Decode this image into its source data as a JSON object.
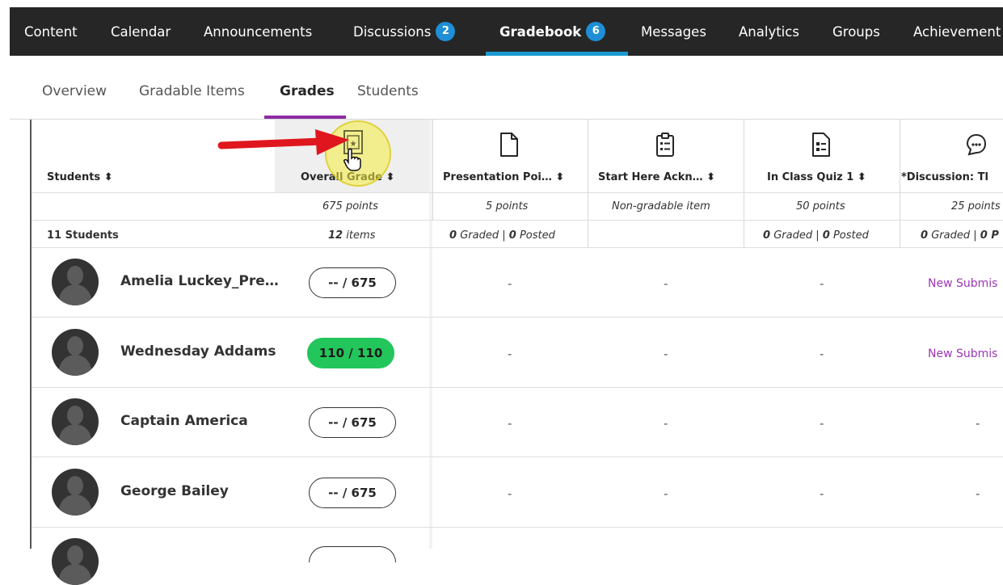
{
  "topnav": {
    "tabs": [
      {
        "label": "Content"
      },
      {
        "label": "Calendar"
      },
      {
        "label": "Announcements"
      },
      {
        "label": "Discussions",
        "badge": "2"
      },
      {
        "label": "Gradebook",
        "badge": "6",
        "active": true
      },
      {
        "label": "Messages"
      },
      {
        "label": "Analytics"
      },
      {
        "label": "Groups"
      },
      {
        "label": "Achievement"
      }
    ]
  },
  "subtabs": [
    {
      "label": "Overview"
    },
    {
      "label": "Gradable Items"
    },
    {
      "label": "Grades",
      "active": true
    },
    {
      "label": "Students"
    }
  ],
  "grid": {
    "students_header": "Students",
    "sort_glyph": "⬍",
    "columns": [
      {
        "label": "Overall Grade",
        "points": "675 points",
        "summary_num": "12",
        "summary_txt": "items",
        "icon": "overall-grade-icon"
      },
      {
        "label": "Presentation Poi…",
        "points": "5 points",
        "graded": "0",
        "posted": "0",
        "icon": "document-icon"
      },
      {
        "label": "Start Here Ackn…",
        "points": "Non-gradable item",
        "icon": "clipboard-icon"
      },
      {
        "label": "In Class Quiz 1",
        "points": "50 points",
        "graded": "0",
        "posted": "0",
        "icon": "quiz-icon"
      },
      {
        "label": "*Discussion: Tl",
        "points": "25 points",
        "graded": "0",
        "posted": "0 P",
        "icon": "discussion-icon"
      }
    ],
    "graded_word": "Graded",
    "posted_word": "Posted",
    "separator": "|",
    "student_count": "11 Students",
    "rows": [
      {
        "name": "Amelia Luckey_Pre…",
        "overall": "-- / 675",
        "c1": "-",
        "c2": "-",
        "c3": "-",
        "c4": "New Submis"
      },
      {
        "name": "Wednesday Addams",
        "overall": "110 / 110",
        "good": true,
        "c1": "-",
        "c2": "-",
        "c3": "-",
        "c4": "New Submis"
      },
      {
        "name": "Captain America",
        "overall": "-- / 675",
        "c1": "-",
        "c2": "-",
        "c3": "-",
        "c4": "-"
      },
      {
        "name": "George Bailey",
        "overall": "-- / 675",
        "c1": "-",
        "c2": "-",
        "c3": "-",
        "c4": "-"
      }
    ]
  },
  "colors": {
    "accent": "#1b9ad1",
    "purple": "#8e2ba4",
    "success": "#22c65b"
  }
}
